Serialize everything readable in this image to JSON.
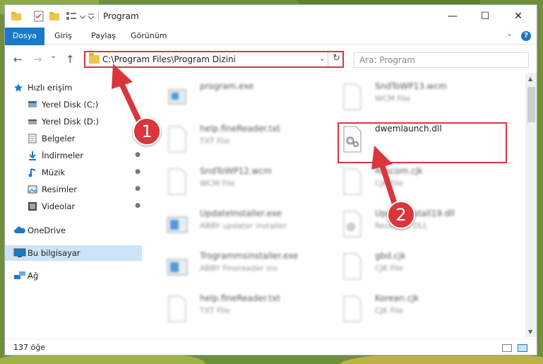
{
  "window": {
    "title": "Program",
    "minimize_glyph": "—",
    "maximize_glyph": "☐",
    "close_glyph": "✕"
  },
  "ribbon": {
    "tabs": [
      "Dosya",
      "Giriş",
      "Paylaş",
      "Görünüm"
    ],
    "expand_glyph": "⌄",
    "help_glyph": "?"
  },
  "nav": {
    "address": "C:\\Program Files\\Program Dizini",
    "search_placeholder": "Ara: Program",
    "back_glyph": "←",
    "forward_glyph": "→",
    "recent_glyph": "⌄",
    "up_glyph": "↑",
    "refresh_glyph": "↻",
    "address_chevron": "⌄"
  },
  "sidebar": {
    "items": [
      {
        "label": "Hızlı erişim",
        "icon": "star-icon",
        "pinned": false
      },
      {
        "label": "Yerel Disk (C:)",
        "icon": "drive-icon",
        "pinned": true
      },
      {
        "label": "Yerel Disk (D:)",
        "icon": "drive-icon",
        "pinned": true
      },
      {
        "label": "Belgeler",
        "icon": "documents-icon",
        "pinned": true
      },
      {
        "label": "İndirmeler",
        "icon": "download-icon",
        "pinned": true
      },
      {
        "label": "Müzik",
        "icon": "music-icon",
        "pinned": true
      },
      {
        "label": "Resimler",
        "icon": "pictures-icon",
        "pinned": true
      },
      {
        "label": "Videolar",
        "icon": "videos-icon",
        "pinned": true
      },
      {
        "label": "OneDrive",
        "icon": "cloud-icon",
        "pinned": false
      },
      {
        "label": "Bu bilgisayar",
        "icon": "computer-icon",
        "pinned": false
      },
      {
        "label": "Ağ",
        "icon": "network-icon",
        "pinned": false
      }
    ],
    "pin_glyph": "📌"
  },
  "files": [
    {
      "name": "program.exe",
      "type": ""
    },
    {
      "name": "SndToWP13.wcm",
      "type": "WCM File"
    },
    {
      "name": "help.fineReader.txt",
      "type": "TXT File"
    },
    {
      "name": "dwemlaunch.dll",
      "type": ""
    },
    {
      "name": "SndToWP12.wcm",
      "type": "WCM File"
    },
    {
      "name": "Rescom.cjk",
      "type": "CJK File"
    },
    {
      "name": "UpdateInstaller.exe",
      "type": "ABBY updater installer"
    },
    {
      "name": "UpdateInstall19.dll",
      "type": "Resource DLL"
    },
    {
      "name": "Trogrammsinstaller.exe",
      "type": "ABBY Finereader ins"
    },
    {
      "name": "gbd.cjk",
      "type": "CJK File"
    },
    {
      "name": "help.fineReader.txt",
      "type": "TXT File"
    },
    {
      "name": "Korean.cjk",
      "type": "CJK File"
    }
  ],
  "status": {
    "count": "137 öğe"
  },
  "annotations": {
    "step1": "1",
    "step2": "2"
  },
  "colors": {
    "accent": "#1979ca",
    "highlight": "#d9373b",
    "selected": "#cce4f7",
    "folder": "#f1c44b"
  }
}
